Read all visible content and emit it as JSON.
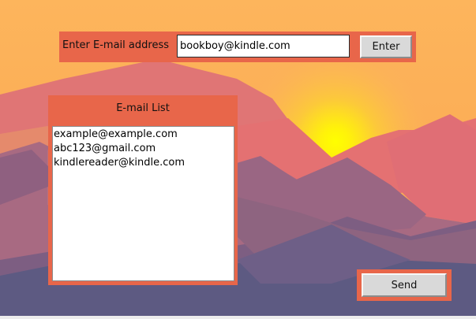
{
  "entry": {
    "label": "Enter E-mail address",
    "value": "bookboy@kindle.com",
    "button_label": "Enter"
  },
  "email_list": {
    "title": "E-mail List",
    "items": [
      "example@example.com",
      "abc123@gmail.com",
      "kindlereader@kindle.com"
    ]
  },
  "send": {
    "button_label": "Send"
  },
  "colors": {
    "panel": "#e8664a",
    "sky": "#fbb45a",
    "sun": "#ffff00",
    "button": "#d9d9d9"
  }
}
